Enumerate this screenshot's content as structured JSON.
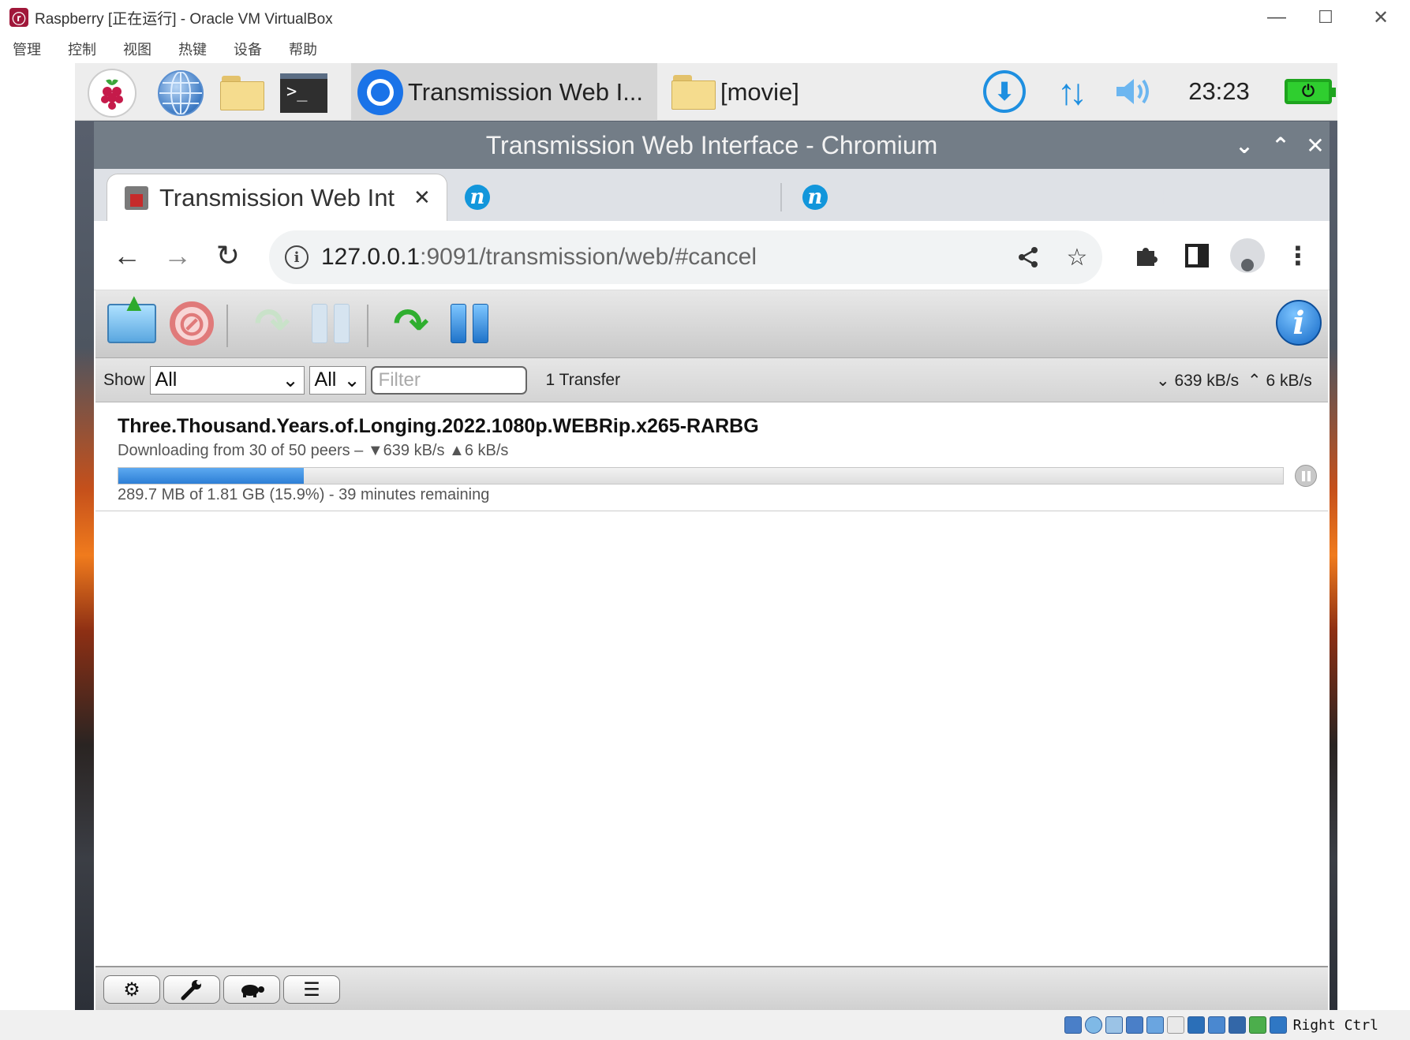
{
  "vbox": {
    "title": "Raspberry [正在运行] - Oracle VM VirtualBox",
    "menu": [
      "管理",
      "控制",
      "视图",
      "热键",
      "设备",
      "帮助"
    ],
    "controls": {
      "minimize": "—",
      "maximize": "☐",
      "close": "✕"
    },
    "statusbar": {
      "host_key": "Right Ctrl"
    }
  },
  "taskbar": {
    "tasks": [
      {
        "label": "Transmission Web I...",
        "icon": "chromium-icon",
        "active": true
      },
      {
        "label": "[movie]",
        "icon": "folder-icon",
        "active": false
      }
    ],
    "clock": "23:23",
    "tray_icons": [
      "download-icon",
      "network-icon",
      "volume-icon",
      "battery-icon"
    ]
  },
  "chromium": {
    "window_title": "Transmission Web Interface - Chromium",
    "tabs": [
      {
        "label": "Transmission Web Int",
        "active": true
      },
      {
        "label": "",
        "active": false
      },
      {
        "label": "",
        "active": false
      }
    ],
    "omnibox": {
      "host": "127.0.0.1",
      "path": ":9091/transmission/web/#cancel"
    }
  },
  "transmission": {
    "filter": {
      "show_label": "Show",
      "state_value": "All",
      "tracker_value": "All",
      "placeholder": "Filter",
      "count": "1 Transfer"
    },
    "speed": {
      "down": "639 kB/s",
      "up": "6 kB/s"
    },
    "torrent": {
      "name": "Three.Thousand.Years.of.Longing.2022.1080p.WEBRip.x265-RARBG",
      "peers": "Downloading from 30 of 50 peers – ▼639 kB/s ▲6 kB/s",
      "progress_fraction": 0.159,
      "progress_color": "#3a8ee6",
      "status": "289.7 MB of 1.81 GB (15.9%) - 39 minutes remaining"
    },
    "bottom_buttons": [
      "gear-icon",
      "wrench-icon",
      "turtle-icon",
      "list-options-icon"
    ]
  }
}
